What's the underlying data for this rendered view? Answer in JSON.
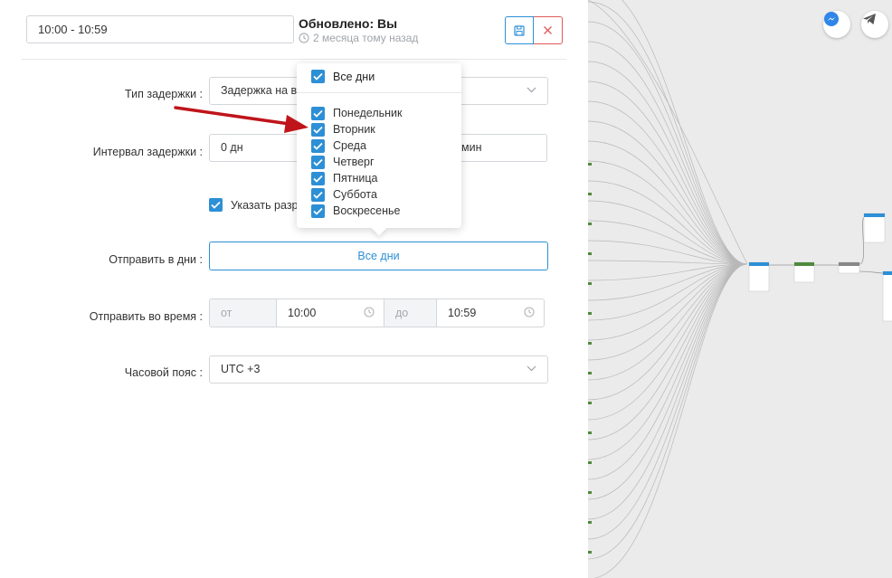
{
  "header": {
    "name_value": "10:00 - 10:59",
    "updated_label": "Обновлено: Вы",
    "updated_ago": "2 месяца тому назад"
  },
  "form": {
    "delay_type": {
      "label": "Тип задержки :",
      "value": "Задержка на в"
    },
    "delay_interval": {
      "label": "Интервал задержки :",
      "days_value": "0 дн",
      "minutes_suffix": "мин"
    },
    "specify_checkbox": {
      "label": "Указать разр",
      "checked": true
    },
    "send_days": {
      "label": "Отправить в дни :",
      "button": "Все дни"
    },
    "send_time": {
      "label": "Отправить во время :",
      "from_label": "от",
      "from_value": "10:00",
      "to_label": "до",
      "to_value": "10:59"
    },
    "timezone": {
      "label": "Часовой пояс :",
      "value": "UTC +3"
    }
  },
  "days_dropdown": {
    "all_label": "Все дни",
    "all_checked": true,
    "days": [
      {
        "label": "Понедельник",
        "checked": true
      },
      {
        "label": "Вторник",
        "checked": true
      },
      {
        "label": "Среда",
        "checked": true
      },
      {
        "label": "Четверг",
        "checked": true
      },
      {
        "label": "Пятница",
        "checked": true
      },
      {
        "label": "Суббота",
        "checked": true
      },
      {
        "label": "Воскресенье",
        "checked": true
      }
    ]
  },
  "colors": {
    "accent": "#2d8fd5",
    "danger": "#e05a5a",
    "arrow": "#c0141b",
    "canvas_bg": "#ebebeb"
  },
  "icons": {
    "messenger": "messenger-icon",
    "telegram": "telegram-icon",
    "save": "floppy-disk-icon",
    "close": "close-icon"
  }
}
